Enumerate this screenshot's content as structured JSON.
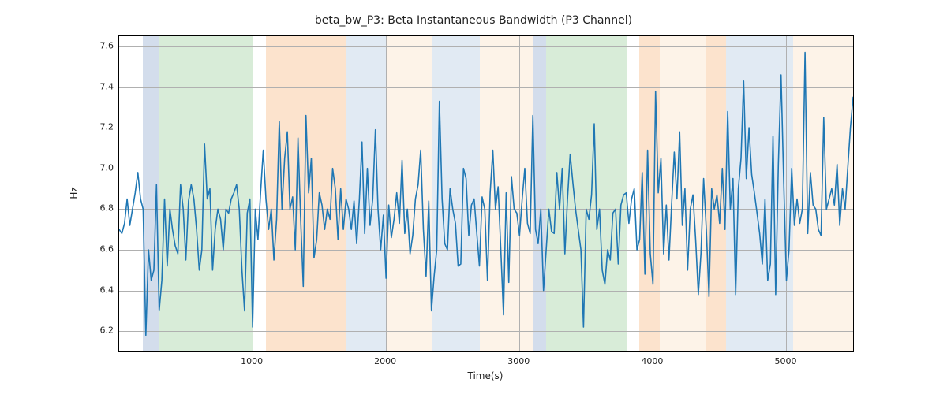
{
  "chart_data": {
    "type": "line",
    "title": "beta_bw_P3: Beta Instantaneous Bandwidth (P3 Channel)",
    "xlabel": "Time(s)",
    "ylabel": "Hz",
    "xlim": [
      0,
      5500
    ],
    "ylim": [
      6.1,
      7.65
    ],
    "xticks": [
      1000,
      2000,
      3000,
      4000,
      5000
    ],
    "yticks": [
      6.2,
      6.4,
      6.6,
      6.8,
      7.0,
      7.2,
      7.4,
      7.6
    ],
    "spans": [
      {
        "x0": 180,
        "x1": 300,
        "color": "#6c8ebf"
      },
      {
        "x0": 300,
        "x1": 1000,
        "color": "#7fbf7f"
      },
      {
        "x0": 1100,
        "x1": 1700,
        "color": "#f5a15b"
      },
      {
        "x0": 1700,
        "x1": 2000,
        "color": "#9db8d8"
      },
      {
        "x0": 2000,
        "x1": 2350,
        "color": "#f8d7b3"
      },
      {
        "x0": 2350,
        "x1": 2700,
        "color": "#9db8d8"
      },
      {
        "x0": 2700,
        "x1": 3100,
        "color": "#f8d7b3"
      },
      {
        "x0": 3100,
        "x1": 3200,
        "color": "#6c8ebf"
      },
      {
        "x0": 3200,
        "x1": 3800,
        "color": "#7fbf7f"
      },
      {
        "x0": 3900,
        "x1": 4050,
        "color": "#f5a15b"
      },
      {
        "x0": 4050,
        "x1": 4400,
        "color": "#f8d7b3"
      },
      {
        "x0": 4400,
        "x1": 4550,
        "color": "#f5a15b"
      },
      {
        "x0": 4550,
        "x1": 5050,
        "color": "#9db8d8"
      },
      {
        "x0": 5050,
        "x1": 5500,
        "color": "#f8d7b3"
      }
    ],
    "series": [
      {
        "name": "beta_bw_P3",
        "color": "#1f77b4",
        "x": [
          0,
          20,
          40,
          60,
          80,
          100,
          120,
          140,
          160,
          180,
          200,
          220,
          240,
          260,
          280,
          300,
          320,
          340,
          360,
          380,
          400,
          420,
          440,
          460,
          480,
          500,
          520,
          540,
          560,
          580,
          600,
          620,
          640,
          660,
          680,
          700,
          720,
          740,
          760,
          780,
          800,
          820,
          840,
          860,
          880,
          900,
          920,
          940,
          960,
          980,
          1000,
          1020,
          1040,
          1060,
          1080,
          1100,
          1120,
          1140,
          1160,
          1180,
          1200,
          1220,
          1240,
          1260,
          1280,
          1300,
          1320,
          1340,
          1360,
          1380,
          1400,
          1420,
          1440,
          1460,
          1480,
          1500,
          1520,
          1540,
          1560,
          1580,
          1600,
          1620,
          1640,
          1660,
          1680,
          1700,
          1720,
          1740,
          1760,
          1780,
          1800,
          1820,
          1840,
          1860,
          1880,
          1900,
          1920,
          1940,
          1960,
          1980,
          2000,
          2020,
          2040,
          2060,
          2080,
          2100,
          2120,
          2140,
          2160,
          2180,
          2200,
          2220,
          2240,
          2260,
          2280,
          2300,
          2320,
          2340,
          2360,
          2380,
          2400,
          2420,
          2440,
          2460,
          2480,
          2500,
          2520,
          2540,
          2560,
          2580,
          2600,
          2620,
          2640,
          2660,
          2680,
          2700,
          2720,
          2740,
          2760,
          2780,
          2800,
          2820,
          2840,
          2860,
          2880,
          2900,
          2920,
          2940,
          2960,
          2980,
          3000,
          3020,
          3040,
          3060,
          3080,
          3100,
          3120,
          3140,
          3160,
          3180,
          3200,
          3220,
          3240,
          3260,
          3280,
          3300,
          3320,
          3340,
          3360,
          3380,
          3400,
          3420,
          3440,
          3460,
          3480,
          3500,
          3520,
          3540,
          3560,
          3580,
          3600,
          3620,
          3640,
          3660,
          3680,
          3700,
          3720,
          3740,
          3760,
          3780,
          3800,
          3820,
          3840,
          3860,
          3880,
          3900,
          3920,
          3940,
          3960,
          3980,
          4000,
          4020,
          4040,
          4060,
          4080,
          4100,
          4120,
          4140,
          4160,
          4180,
          4200,
          4220,
          4240,
          4260,
          4280,
          4300,
          4320,
          4340,
          4360,
          4380,
          4400,
          4420,
          4440,
          4460,
          4480,
          4500,
          4520,
          4540,
          4560,
          4580,
          4600,
          4620,
          4640,
          4660,
          4680,
          4700,
          4720,
          4740,
          4760,
          4780,
          4800,
          4820,
          4840,
          4860,
          4880,
          4900,
          4920,
          4940,
          4960,
          4980,
          5000,
          5020,
          5040,
          5060,
          5080,
          5100,
          5120,
          5140,
          5160,
          5180,
          5200,
          5220,
          5240,
          5260,
          5280,
          5300,
          5320,
          5340,
          5360,
          5380,
          5400,
          5420,
          5440,
          5460,
          5480,
          5500
        ],
        "y": [
          6.7,
          6.68,
          6.73,
          6.85,
          6.72,
          6.8,
          6.88,
          6.98,
          6.85,
          6.8,
          6.18,
          6.6,
          6.45,
          6.5,
          6.92,
          6.3,
          6.45,
          6.85,
          6.52,
          6.8,
          6.7,
          6.62,
          6.58,
          6.92,
          6.8,
          6.55,
          6.84,
          6.92,
          6.85,
          6.7,
          6.5,
          6.6,
          7.12,
          6.85,
          6.9,
          6.5,
          6.7,
          6.8,
          6.75,
          6.6,
          6.8,
          6.78,
          6.85,
          6.88,
          6.92,
          6.8,
          6.5,
          6.3,
          6.78,
          6.85,
          6.22,
          6.8,
          6.65,
          6.88,
          7.09,
          6.85,
          6.7,
          6.8,
          6.55,
          6.75,
          7.23,
          6.8,
          7.05,
          7.18,
          6.8,
          6.86,
          6.6,
          7.15,
          6.75,
          6.42,
          7.26,
          6.88,
          7.05,
          6.56,
          6.65,
          6.88,
          6.82,
          6.7,
          6.8,
          6.75,
          7.0,
          6.9,
          6.65,
          6.9,
          6.7,
          6.85,
          6.8,
          6.7,
          6.84,
          6.63,
          6.85,
          7.13,
          6.68,
          7.0,
          6.72,
          6.85,
          7.19,
          6.8,
          6.6,
          6.77,
          6.46,
          6.82,
          6.66,
          6.75,
          6.88,
          6.73,
          7.04,
          6.68,
          6.8,
          6.58,
          6.67,
          6.85,
          6.92,
          7.09,
          6.7,
          6.47,
          6.84,
          6.3,
          6.47,
          6.6,
          7.33,
          6.85,
          6.63,
          6.6,
          6.9,
          6.8,
          6.73,
          6.52,
          6.53,
          7.0,
          6.95,
          6.67,
          6.82,
          6.85,
          6.68,
          6.52,
          6.86,
          6.8,
          6.45,
          6.88,
          7.09,
          6.8,
          6.91,
          6.6,
          6.28,
          6.88,
          6.44,
          6.96,
          6.8,
          6.78,
          6.67,
          6.85,
          7.0,
          6.73,
          6.68,
          7.26,
          6.7,
          6.63,
          6.8,
          6.4,
          6.6,
          6.8,
          6.69,
          6.68,
          6.98,
          6.8,
          7.0,
          6.58,
          6.85,
          7.07,
          6.93,
          6.8,
          6.7,
          6.6,
          6.22,
          6.8,
          6.75,
          6.87,
          7.22,
          6.7,
          6.8,
          6.5,
          6.43,
          6.6,
          6.55,
          6.78,
          6.8,
          6.53,
          6.82,
          6.87,
          6.88,
          6.73,
          6.85,
          6.9,
          6.6,
          6.65,
          6.98,
          6.48,
          7.09,
          6.58,
          6.43,
          7.38,
          6.88,
          7.05,
          6.58,
          6.82,
          6.55,
          6.82,
          7.08,
          6.85,
          7.18,
          6.72,
          6.9,
          6.5,
          6.8,
          6.87,
          6.65,
          6.38,
          6.58,
          6.95,
          6.7,
          6.37,
          6.9,
          6.8,
          6.87,
          6.73,
          7.0,
          6.7,
          7.28,
          6.8,
          6.95,
          6.38,
          6.9,
          7.05,
          7.43,
          6.95,
          7.2,
          6.97,
          6.88,
          6.78,
          6.68,
          6.53,
          6.85,
          6.45,
          6.53,
          7.16,
          6.38,
          7.02,
          7.46,
          6.93,
          6.45,
          6.6,
          7.0,
          6.72,
          6.85,
          6.73,
          6.8,
          7.57,
          6.68,
          6.98,
          6.82,
          6.8,
          6.7,
          6.67,
          7.25,
          6.8,
          6.85,
          6.9,
          6.82,
          7.02,
          6.72,
          6.9,
          6.8,
          7.0,
          7.2,
          7.35
        ]
      }
    ]
  }
}
